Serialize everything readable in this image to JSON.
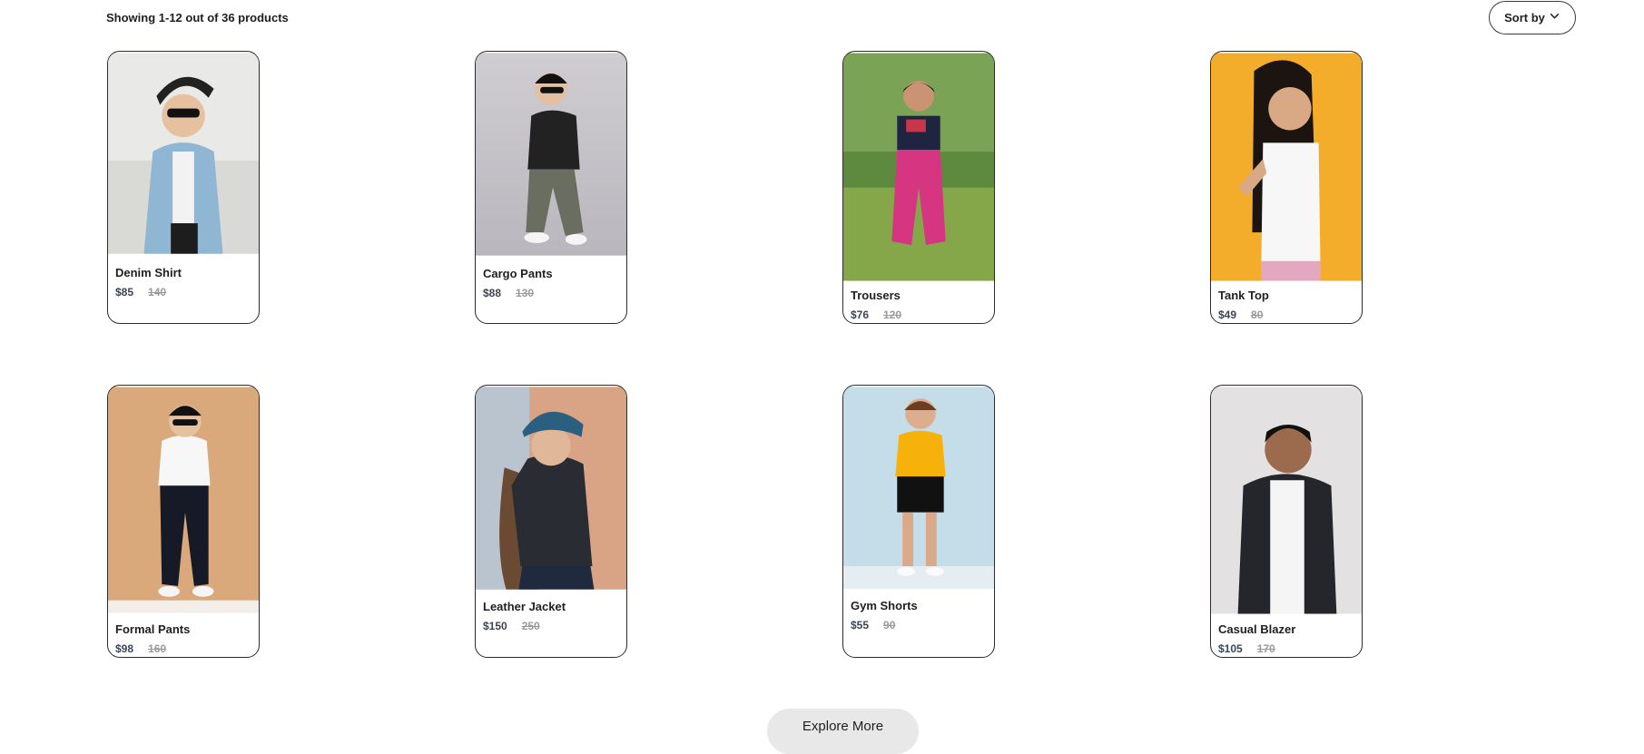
{
  "results": {
    "summary": "Showing 1-12 out of 36 products"
  },
  "sort": {
    "label": "Sort by",
    "icon": "chevron-down-icon"
  },
  "products": [
    {
      "name": "Denim Shirt",
      "price": "$85",
      "old_price": "140"
    },
    {
      "name": "Cargo Pants",
      "price": "$88",
      "old_price": "130"
    },
    {
      "name": "Trousers",
      "price": "$76",
      "old_price": "120"
    },
    {
      "name": "Tank Top",
      "price": "$49",
      "old_price": "80"
    },
    {
      "name": "Formal Pants",
      "price": "$98",
      "old_price": "160"
    },
    {
      "name": "Leather Jacket",
      "price": "$150",
      "old_price": "250"
    },
    {
      "name": "Gym Shorts",
      "price": "$55",
      "old_price": "90"
    },
    {
      "name": "Casual Blazer",
      "price": "$105",
      "old_price": "170"
    }
  ],
  "explore": {
    "label": "Explore More"
  },
  "colors": {
    "border": "#2b2b2b",
    "price": "#3a4557",
    "old_price": "#9a9a9a",
    "button_bg": "#e8e8e8"
  }
}
